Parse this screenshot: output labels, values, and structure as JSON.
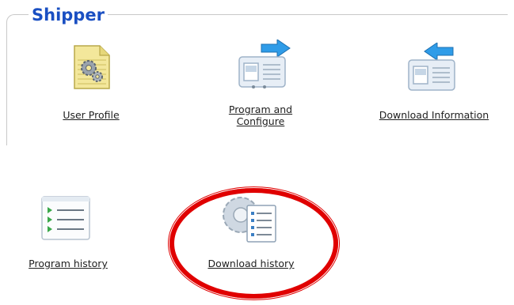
{
  "section": {
    "title": "Shipper"
  },
  "items": {
    "user_profile": {
      "label": "User Profile",
      "icon": "document-gear-icon"
    },
    "program_configure": {
      "label_line1": "Program and",
      "label_line2": "Configure",
      "icon": "device-send-icon"
    },
    "download_information": {
      "label": "Download Information",
      "icon": "device-receive-icon"
    },
    "program_history": {
      "label": "Program history",
      "icon": "checklist-icon"
    },
    "download_history": {
      "label": "Download history",
      "icon": "gear-document-icon"
    }
  },
  "highlight": {
    "color": "#e00000",
    "target": "download_history"
  },
  "colors": {
    "title": "#1a4fc2",
    "border": "#c8c8c8"
  }
}
